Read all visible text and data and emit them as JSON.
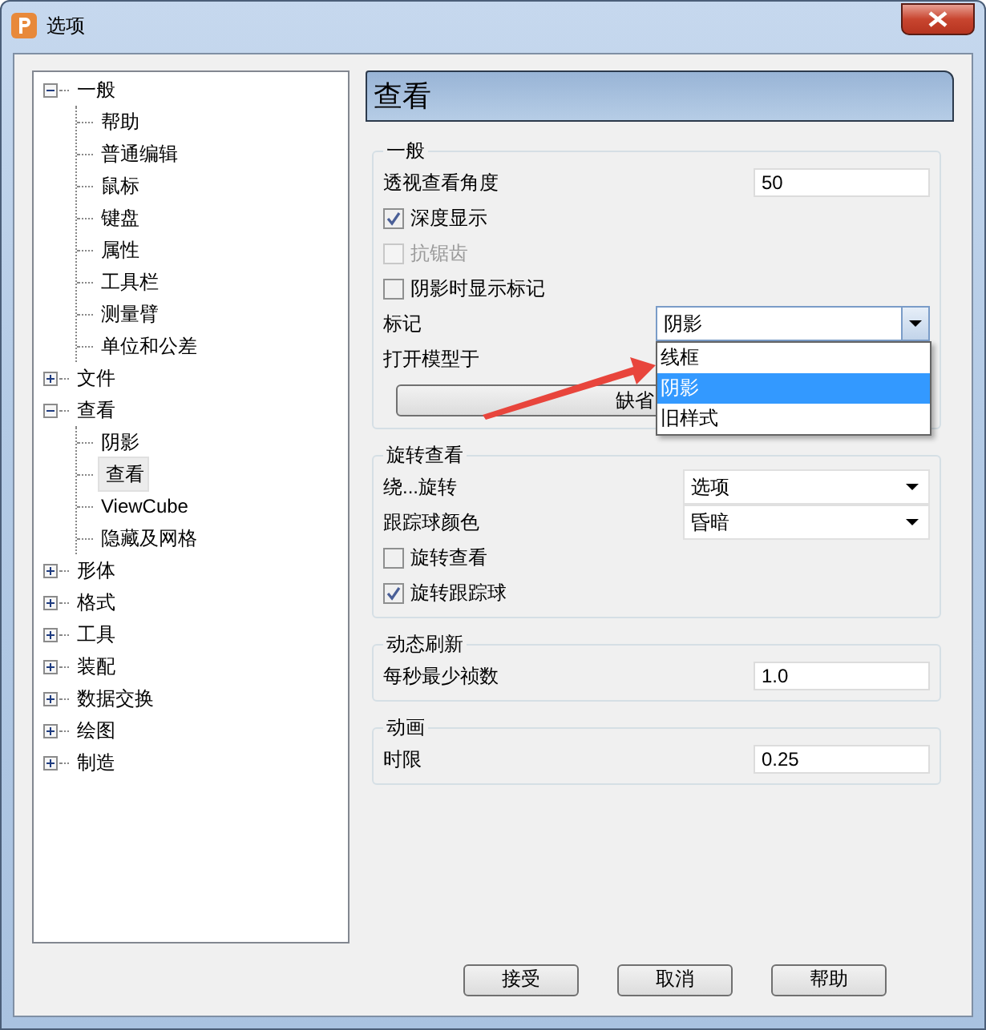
{
  "window": {
    "title": "选项"
  },
  "tree": [
    {
      "label": "一般",
      "expanded": true,
      "selected": false,
      "children": [
        {
          "label": "帮助",
          "selected": false
        },
        {
          "label": "普通编辑",
          "selected": false
        },
        {
          "label": "鼠标",
          "selected": false
        },
        {
          "label": "键盘",
          "selected": false
        },
        {
          "label": "属性",
          "selected": false
        },
        {
          "label": "工具栏",
          "selected": false
        },
        {
          "label": "测量臂",
          "selected": false
        },
        {
          "label": "单位和公差",
          "selected": false
        }
      ]
    },
    {
      "label": "文件",
      "expanded": false,
      "selected": false
    },
    {
      "label": "查看",
      "expanded": true,
      "selected": false,
      "children": [
        {
          "label": "阴影",
          "selected": false
        },
        {
          "label": "查看",
          "selected": true
        },
        {
          "label": "ViewCube",
          "selected": false
        },
        {
          "label": "隐藏及网格",
          "selected": false
        }
      ]
    },
    {
      "label": "形体",
      "expanded": false,
      "selected": false
    },
    {
      "label": "格式",
      "expanded": false,
      "selected": false
    },
    {
      "label": "工具",
      "expanded": false,
      "selected": false
    },
    {
      "label": "装配",
      "expanded": false,
      "selected": false
    },
    {
      "label": "数据交换",
      "expanded": false,
      "selected": false
    },
    {
      "label": "绘图",
      "expanded": false,
      "selected": false
    },
    {
      "label": "制造",
      "expanded": false,
      "selected": false
    }
  ],
  "panel": {
    "title": "查看"
  },
  "groups": [
    {
      "title": "一般",
      "rows": [
        {
          "kind": "text",
          "label": "透视查看角度",
          "value": "50"
        },
        {
          "kind": "checkbox",
          "label": "深度显示",
          "checked": true,
          "disabled": false
        },
        {
          "kind": "checkbox",
          "label": "抗锯齿",
          "checked": false,
          "disabled": true
        },
        {
          "kind": "checkbox",
          "label": "阴影时显示标记",
          "checked": false,
          "disabled": false
        },
        {
          "kind": "select",
          "label": "标记",
          "value": "阴影",
          "expanded": true,
          "options": [
            {
              "label": "线框",
              "selected": false
            },
            {
              "label": "阴影",
              "selected": true
            },
            {
              "label": "旧样式",
              "selected": false
            }
          ]
        },
        {
          "kind": "label",
          "label": "打开模型于"
        },
        {
          "kind": "button",
          "label": "缺省"
        }
      ]
    },
    {
      "title": "旋转查看",
      "rows": [
        {
          "kind": "select",
          "label": "绕...旋转",
          "value": "选项",
          "expanded": false
        },
        {
          "kind": "select",
          "label": "跟踪球颜色",
          "value": "昏暗",
          "expanded": false
        },
        {
          "kind": "checkbox",
          "label": "旋转查看",
          "checked": false,
          "disabled": false
        },
        {
          "kind": "checkbox",
          "label": "旋转跟踪球",
          "checked": true,
          "disabled": false
        }
      ]
    },
    {
      "title": "动态刷新",
      "rows": [
        {
          "kind": "text",
          "label": "每秒最少祯数",
          "value": "1.0"
        }
      ]
    },
    {
      "title": "动画",
      "rows": [
        {
          "kind": "text",
          "label": "时限",
          "value": "0.25"
        }
      ]
    }
  ],
  "buttons": [
    "接受",
    "取消",
    "帮助"
  ],
  "annotation": {
    "kind": "arrow"
  }
}
